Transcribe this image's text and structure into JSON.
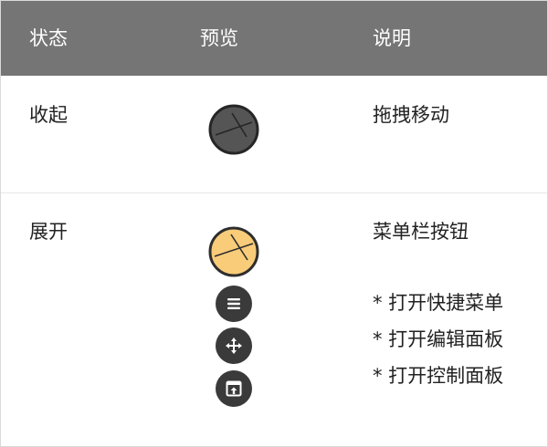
{
  "table": {
    "headers": {
      "state": "状态",
      "preview": "预览",
      "description": "说明"
    },
    "rows": [
      {
        "state": "收起",
        "description": "拖拽移动",
        "icons": [
          "collapsed-ball-icon"
        ]
      },
      {
        "state": "展开",
        "description": "菜单栏按钮",
        "icons": [
          "expanded-ball-icon",
          "menu-icon",
          "move-icon",
          "panel-icon"
        ],
        "items": [
          "* 打开快捷菜单",
          "* 打开编辑面板",
          "* 打开控制面板"
        ]
      }
    ]
  },
  "colors": {
    "header_bg": "#757575",
    "header_text": "#ffffff",
    "collapsed_ball": "#555555",
    "expanded_ball": "#f9cc7a",
    "button_bg": "#3a3a3a"
  }
}
